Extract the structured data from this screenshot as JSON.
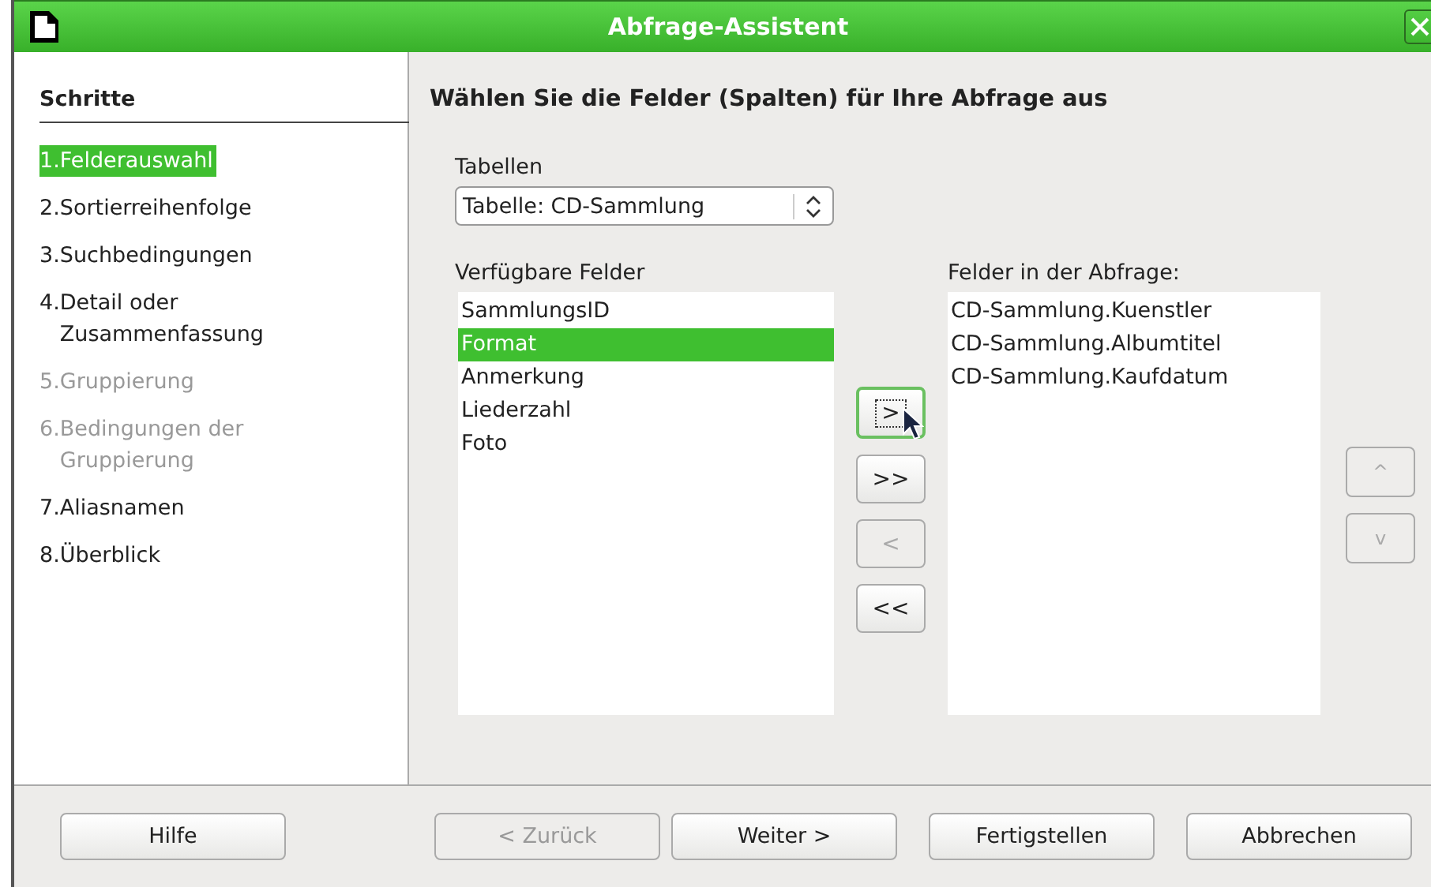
{
  "window": {
    "title": "Abfrage-Assistent"
  },
  "sidebar": {
    "heading": "Schritte",
    "steps": [
      {
        "number": "1.",
        "label": "Felderauswahl",
        "selected": true,
        "disabled": false
      },
      {
        "number": "2.",
        "label": "Sortierreihenfolge",
        "selected": false,
        "disabled": false
      },
      {
        "number": "3.",
        "label": "Suchbedingungen",
        "selected": false,
        "disabled": false
      },
      {
        "number": "4.",
        "label": "Detail oder Zusammenfassung",
        "selected": false,
        "disabled": false
      },
      {
        "number": "5.",
        "label": "Gruppierung",
        "selected": false,
        "disabled": true
      },
      {
        "number": "6.",
        "label": "Bedingungen der Gruppierung",
        "selected": false,
        "disabled": true
      },
      {
        "number": "7.",
        "label": "Aliasnamen",
        "selected": false,
        "disabled": false
      },
      {
        "number": "8.",
        "label": "Überblick",
        "selected": false,
        "disabled": false
      }
    ]
  },
  "page": {
    "heading": "Wählen Sie die Felder (Spalten) für Ihre Abfrage aus",
    "tables": {
      "label": "Tabellen",
      "value": "Tabelle: CD-Sammlung"
    },
    "available": {
      "label": "Verfügbare Felder",
      "items": [
        {
          "text": "SammlungsID",
          "selected": false
        },
        {
          "text": "Format",
          "selected": true
        },
        {
          "text": "Anmerkung",
          "selected": false
        },
        {
          "text": "Liederzahl",
          "selected": false
        },
        {
          "text": "Foto",
          "selected": false
        }
      ]
    },
    "move_buttons": [
      {
        "label": ">",
        "disabled": false,
        "focused": true
      },
      {
        "label": ">>",
        "disabled": false,
        "focused": false
      },
      {
        "label": "<",
        "disabled": true,
        "focused": false
      },
      {
        "label": "<<",
        "disabled": false,
        "focused": false
      }
    ],
    "query": {
      "label": "Felder in der Abfrage:",
      "items": [
        {
          "text": "CD-Sammlung.Kuenstler",
          "selected": false
        },
        {
          "text": "CD-Sammlung.Albumtitel",
          "selected": false
        },
        {
          "text": "CD-Sammlung.Kaufdatum",
          "selected": false
        }
      ]
    },
    "order_buttons": [
      {
        "label": "^",
        "disabled": true
      },
      {
        "label": "v",
        "disabled": true
      }
    ]
  },
  "footer": {
    "buttons": [
      {
        "label": "Hilfe",
        "disabled": false
      },
      {
        "label": "< Zurück",
        "disabled": true
      },
      {
        "label": "Weiter >",
        "disabled": false
      },
      {
        "label": "Fertigstellen",
        "disabled": false
      },
      {
        "label": "Abbrechen",
        "disabled": false
      }
    ]
  }
}
